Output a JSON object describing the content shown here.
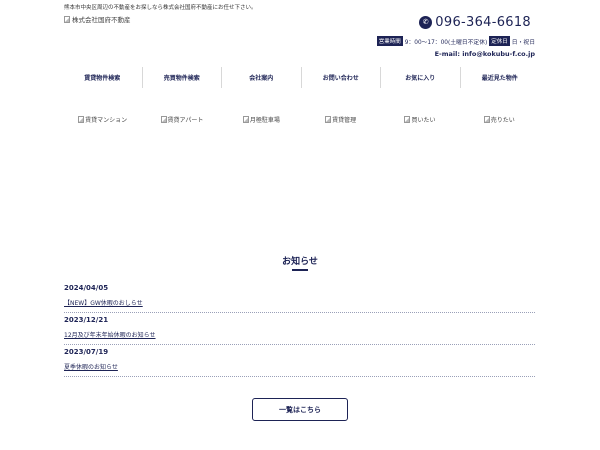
{
  "header": {
    "tagline": "熊本市中央区周辺の不動産をお探しなら株式会社国府不動産にお任せ下さい。",
    "logo_alt": "株式会社国府不動産",
    "phone": "096-364-6618",
    "hours_tag": "営業時間",
    "hours": "9：00～17：00(土曜日不定休)",
    "holiday_tag": "定休日",
    "holiday": "日・祝日",
    "email": "E-mail: info@kokubu-f.co.jp"
  },
  "nav": [
    {
      "label": "賃貸物件検索"
    },
    {
      "label": "売買物件検索"
    },
    {
      "label": "会社案内"
    },
    {
      "label": "お問い合わせ"
    },
    {
      "label": "お気に入り"
    },
    {
      "label": "最近見た物件"
    }
  ],
  "categories": [
    {
      "label": "賃貸マンション"
    },
    {
      "label": "賃貸アパート"
    },
    {
      "label": "月極駐車場"
    },
    {
      "label": "賃貸管理"
    },
    {
      "label": "買いたい"
    },
    {
      "label": "売りたい"
    }
  ],
  "news": {
    "heading": "お知らせ",
    "items": [
      {
        "date": "2024/04/05",
        "title": "【NEW】GW休暇のおしらせ"
      },
      {
        "date": "2023/12/21",
        "title": "12月及び年末年始休暇のお知らせ"
      },
      {
        "date": "2023/07/19",
        "title": "夏季休暇のお知らせ"
      }
    ],
    "more_label": "一覧はこちら"
  },
  "colors": {
    "primary": "#1d2355"
  }
}
